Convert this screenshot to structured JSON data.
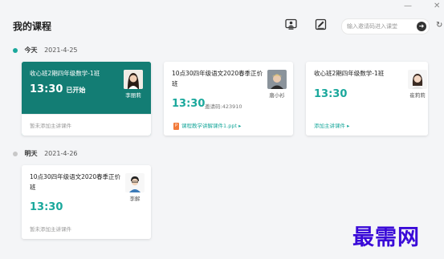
{
  "window": {
    "minimize_glyph": "—",
    "close_glyph": "✕"
  },
  "header": {
    "title": "我的课程",
    "search_placeholder": "输入邀请码进入课堂",
    "search_value": "",
    "search_go_glyph": "➜",
    "refresh_glyph": "↻"
  },
  "sections": [
    {
      "day": "今天",
      "date": "2021-4-25",
      "dot_color": "#1aa89c",
      "cards": [
        {
          "title": "收心班2期四年级数学-1班",
          "time": "13:30",
          "status": "已开始",
          "teacher": "李丽莉",
          "footer": "暂未添加主讲课件"
        },
        {
          "title": "10点30四年级语文2020春季正价班",
          "time": "13:30",
          "code": "邀请码:423910",
          "teacher": "唐小衫",
          "footer": "课程教学讲解课件1.ppt ▸"
        },
        {
          "title": "收心班2期四年级数学-1班",
          "time": "13:30",
          "teacher": "崔莉莉",
          "footer": "添加主讲课件 ▸"
        }
      ]
    },
    {
      "day": "明天",
      "date": "2021-4-26",
      "dot_color": "#c8c8c8",
      "cards": [
        {
          "title": "10点30四年级语文2020春季正价班",
          "time": "13:30",
          "teacher": "李解",
          "footer": "暂未添加主讲课件"
        }
      ]
    }
  ],
  "watermark": "最需网",
  "colors": {
    "accent": "#1aa89c",
    "active_card": "#137d74",
    "ppt_orange": "#f27a3a"
  },
  "icons": {
    "header_1": "monitor-person-icon",
    "header_2": "pen-edit-icon"
  }
}
